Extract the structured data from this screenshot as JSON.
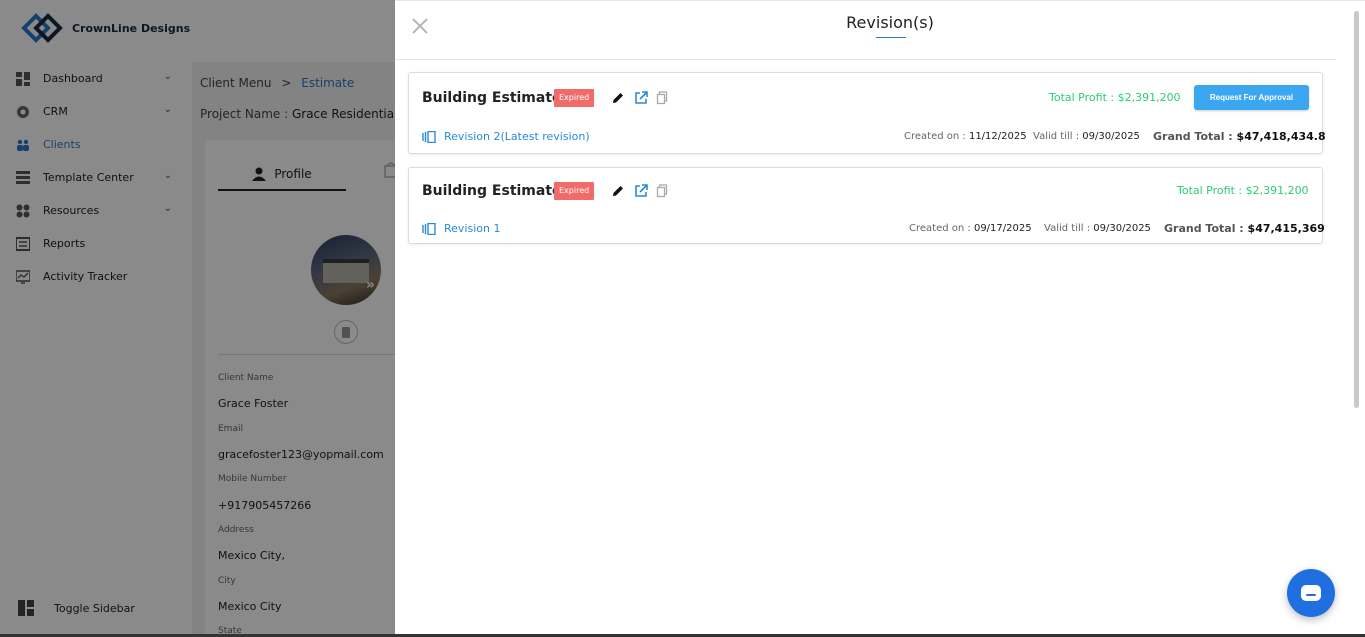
{
  "brand": {
    "name": "CrownLine Designs"
  },
  "sidebar": {
    "items": [
      {
        "label": "Dashboard",
        "icon": "dashboard-icon",
        "has_chevron": true,
        "active": false
      },
      {
        "label": "CRM",
        "icon": "crm-icon",
        "has_chevron": true,
        "active": false
      },
      {
        "label": "Clients",
        "icon": "clients-icon",
        "has_chevron": false,
        "active": true
      },
      {
        "label": "Template Center",
        "icon": "template-icon",
        "has_chevron": true,
        "active": false
      },
      {
        "label": "Resources",
        "icon": "resources-icon",
        "has_chevron": true,
        "active": false
      },
      {
        "label": "Reports",
        "icon": "reports-icon",
        "has_chevron": false,
        "active": false
      },
      {
        "label": "Activity Tracker",
        "icon": "activity-icon",
        "has_chevron": false,
        "active": false
      }
    ],
    "toggle_label": "Toggle Sidebar"
  },
  "breadcrumb": {
    "parent": "Client Menu",
    "separator": ">",
    "current": "Estimate"
  },
  "project": {
    "label": "Project Name :",
    "value": "Grace Residential"
  },
  "profile": {
    "tab_label": "Profile",
    "fields": [
      {
        "label": "Client Name",
        "value": "Grace Foster"
      },
      {
        "label": "Email",
        "value": "gracefoster123@yopmail.com"
      },
      {
        "label": "Mobile Number",
        "value": "+917905457266"
      },
      {
        "label": "Address",
        "value": "Mexico City,"
      },
      {
        "label": "City",
        "value": "Mexico City"
      },
      {
        "label": "State",
        "value": ""
      }
    ]
  },
  "drawer": {
    "title": "Revision(s)",
    "revisions": [
      {
        "title": "Building Estimate",
        "status": "Expired",
        "total_profit": "Total Profit : $2,391,200",
        "action_label": "Request For Approval",
        "revision_label": "Revision 2(Latest revision)",
        "created_label": "Created on :",
        "created_on": "11/12/2025",
        "valid_label": "Valid till :",
        "valid_till": "09/30/2025",
        "grand_label": "Grand Total :",
        "grand_total": "$47,418,434.8"
      },
      {
        "title": "Building Estimate",
        "status": "Expired",
        "total_profit": "Total Profit : $2,391,200",
        "revision_label": "Revision 1",
        "created_label": "Created on :",
        "created_on": "09/17/2025",
        "valid_label": "Valid till :",
        "valid_till": "09/30/2025",
        "grand_label": "Grand Total :",
        "grand_total": "$47,415,369"
      }
    ]
  },
  "colors": {
    "accent": "#2a78c8",
    "profit": "#2ecc71",
    "expired_badge": "#f26b6b",
    "approve_button": "#3ba7f0",
    "chat_button": "#1f6fe0"
  }
}
